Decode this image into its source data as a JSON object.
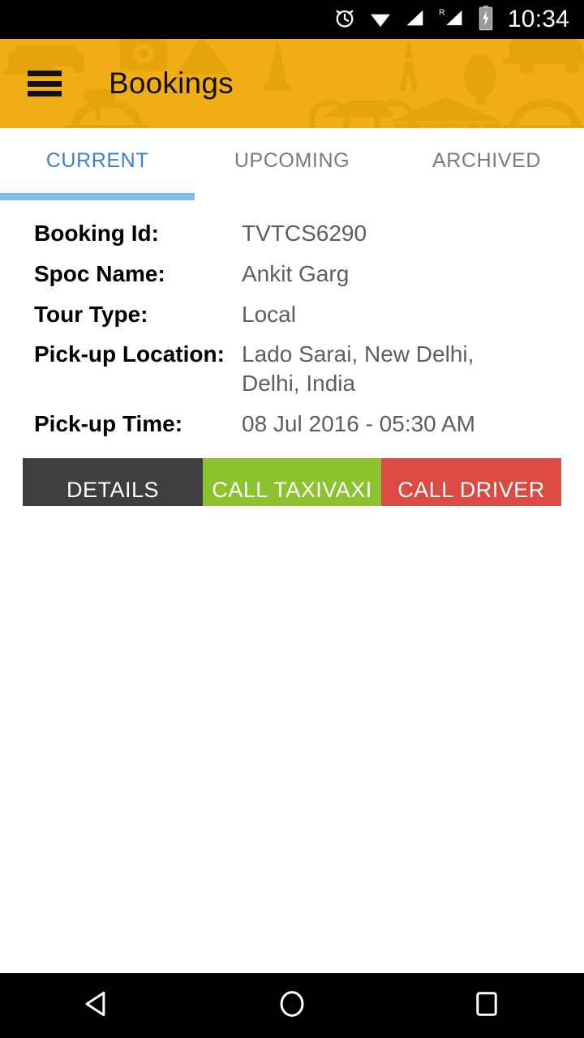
{
  "status_bar": {
    "time": "10:34",
    "icons": [
      {
        "name": "alarm-clock-icon"
      },
      {
        "name": "wifi-icon"
      },
      {
        "name": "cellular-signal-icon"
      },
      {
        "name": "roaming-signal-icon",
        "label": "R"
      },
      {
        "name": "battery-charging-icon"
      }
    ]
  },
  "app_bar": {
    "menu_icon": "hamburger-menu-icon",
    "title": "Bookings",
    "background_color": "#F0AD16",
    "pattern_color": "#E5A30C"
  },
  "tabs": {
    "items": [
      {
        "label": "CURRENT",
        "active": true
      },
      {
        "label": "UPCOMING",
        "active": false
      },
      {
        "label": "ARCHIVED",
        "active": false
      }
    ],
    "active_color": "#3B82C4",
    "inactive_color": "#7A7A7A",
    "indicator_color": "#7FBCE8"
  },
  "booking": {
    "fields": [
      {
        "label": "Booking Id:",
        "value": "TVTCS6290"
      },
      {
        "label": "Spoc Name:",
        "value": "Ankit Garg"
      },
      {
        "label": "Tour Type:",
        "value": "Local"
      },
      {
        "label": "Pick-up Location:",
        "value": "Lado Sarai, New Delhi, Delhi, India"
      },
      {
        "label": "Pick-up Time:",
        "value": "08 Jul 2016 - 05:30 AM"
      }
    ],
    "actions": [
      {
        "label": "DETAILS",
        "color": "#3E3E3E"
      },
      {
        "label": "CALL TAXIVAXI",
        "color": "#8CC22E"
      },
      {
        "label": "CALL DRIVER",
        "color": "#DB4A43"
      }
    ]
  },
  "nav_bar": {
    "back": "back-triangle-icon",
    "home": "home-circle-icon",
    "recents": "recents-square-icon"
  }
}
